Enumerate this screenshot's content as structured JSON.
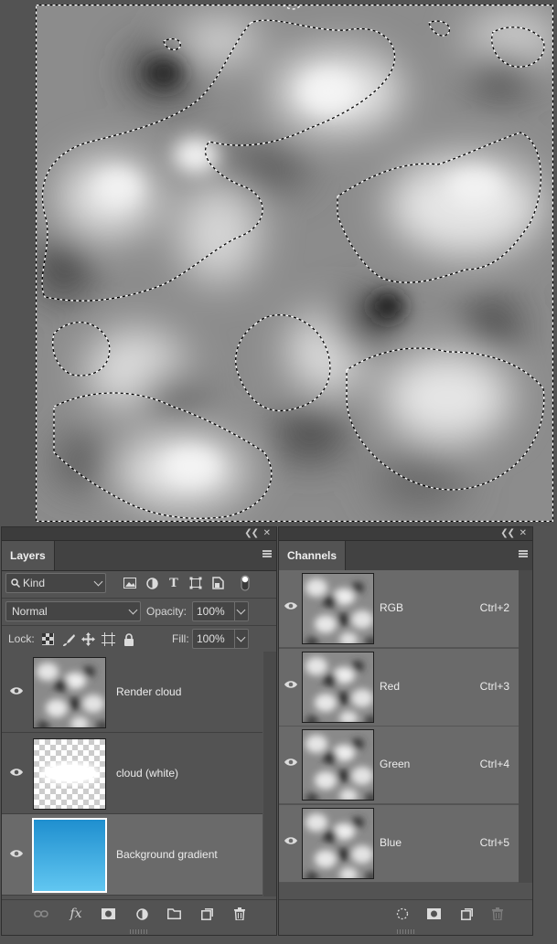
{
  "layers_panel": {
    "tab": "Layers",
    "filter": {
      "kind_label": "Kind",
      "icons": [
        "pixel-filter-icon",
        "adjustment-filter-icon",
        "type-filter-icon",
        "shape-filter-icon",
        "smart-object-filter-icon",
        "filter-toggle-icon"
      ]
    },
    "blend_mode": "Normal",
    "opacity_label": "Opacity:",
    "opacity_value": "100%",
    "lock_label": "Lock:",
    "fill_label": "Fill:",
    "fill_value": "100%",
    "layers": [
      {
        "name": "Render cloud",
        "visible": true,
        "selected": false,
        "thumb": "clouds"
      },
      {
        "name": "cloud (white)",
        "visible": true,
        "selected": false,
        "thumb": "white-cloud"
      },
      {
        "name": "Background gradient",
        "visible": true,
        "selected": true,
        "thumb": "gradient"
      }
    ],
    "bottom_icons": [
      "link-layers-icon",
      "fx-icon",
      "add-mask-icon",
      "adjustment-layer-icon",
      "new-group-icon",
      "new-layer-icon",
      "delete-layer-icon"
    ],
    "fx_label": "fx"
  },
  "channels_panel": {
    "tab": "Channels",
    "channels": [
      {
        "name": "RGB",
        "shortcut": "Ctrl+2"
      },
      {
        "name": "Red",
        "shortcut": "Ctrl+3"
      },
      {
        "name": "Green",
        "shortcut": "Ctrl+4"
      },
      {
        "name": "Blue",
        "shortcut": "Ctrl+5"
      }
    ],
    "bottom_icons": [
      "load-selection-icon",
      "save-selection-icon",
      "new-channel-icon",
      "delete-channel-icon"
    ]
  },
  "colors": {
    "ui_background": "#535353",
    "selected_row": "#6a6a6a",
    "gradient_top": "#1f8fcf",
    "gradient_bottom": "#63c8f2"
  }
}
